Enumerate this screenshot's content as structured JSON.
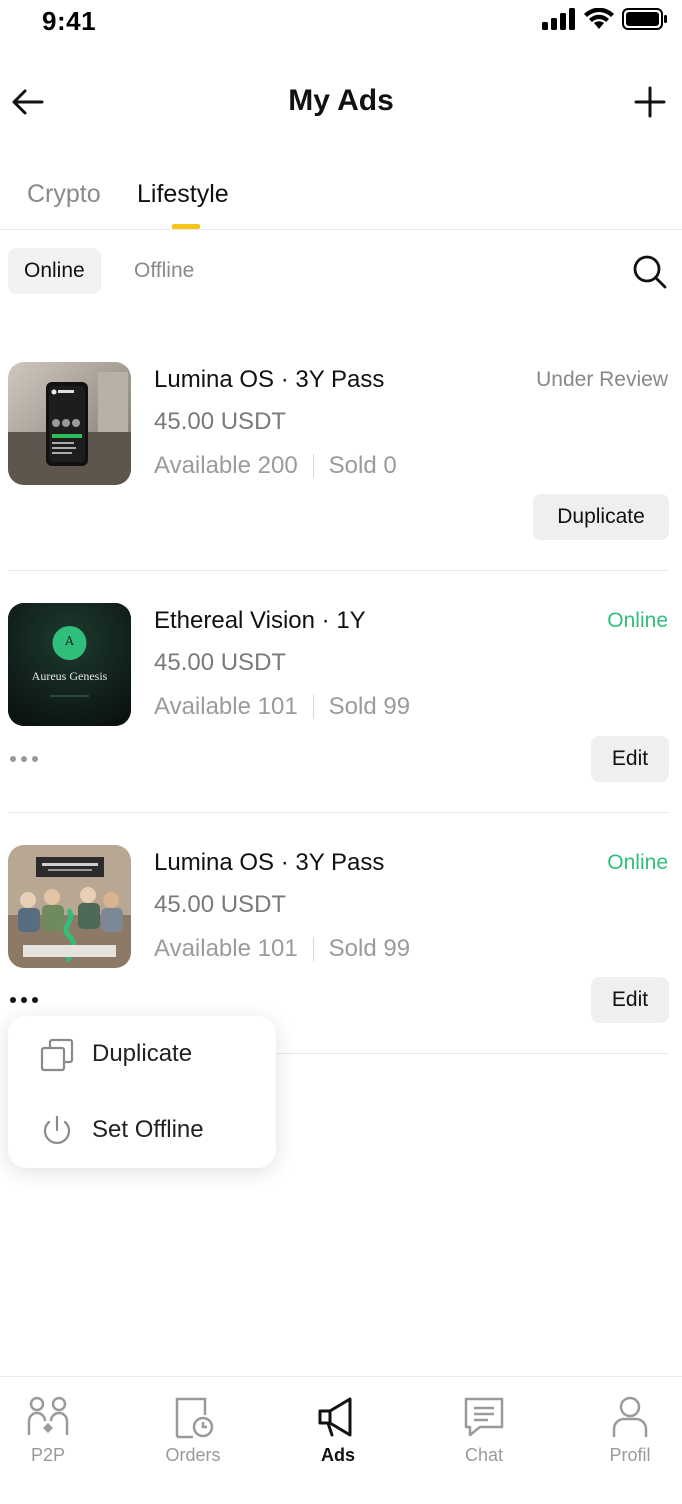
{
  "status_bar": {
    "time": "9:41"
  },
  "header": {
    "title": "My Ads"
  },
  "tabs": [
    {
      "label": "Crypto",
      "active": false
    },
    {
      "label": "Lifestyle",
      "active": true
    }
  ],
  "filters": {
    "online_label": "Online",
    "offline_label": "Offline",
    "selected": "Online"
  },
  "ads": [
    {
      "title": "Lumina OS · 3Y Pass",
      "status": "Under Review",
      "price": "45.00 USDT",
      "available": "Available 200",
      "sold": "Sold 0",
      "action": "Duplicate"
    },
    {
      "title": "Ethereal Vision · 1Y",
      "status": "Online",
      "price": "45.00 USDT",
      "available": "Available 101",
      "sold": "Sold 99",
      "action": "Edit",
      "thumb_text": "Aureus Genesis",
      "thumb_badge": "A"
    },
    {
      "title": "Lumina OS · 3Y Pass",
      "status": "Online",
      "price": "45.00 USDT",
      "available": "Available 101",
      "sold": "Sold 99",
      "action": "Edit"
    }
  ],
  "context_menu": [
    {
      "label": "Duplicate",
      "icon": "duplicate-icon"
    },
    {
      "label": "Set Offline",
      "icon": "power-icon"
    }
  ],
  "bottom_nav": [
    {
      "label": "P2P",
      "icon": "p2p-icon",
      "active": false
    },
    {
      "label": "Orders",
      "icon": "orders-icon",
      "active": false
    },
    {
      "label": "Ads",
      "icon": "megaphone-icon",
      "active": true
    },
    {
      "label": "Chat",
      "icon": "chat-icon",
      "active": false
    },
    {
      "label": "Profil",
      "icon": "profile-icon",
      "active": false
    }
  ],
  "colors": {
    "accent": "#f5c518",
    "online": "#2fbf7a",
    "muted": "#9b9b9b"
  }
}
